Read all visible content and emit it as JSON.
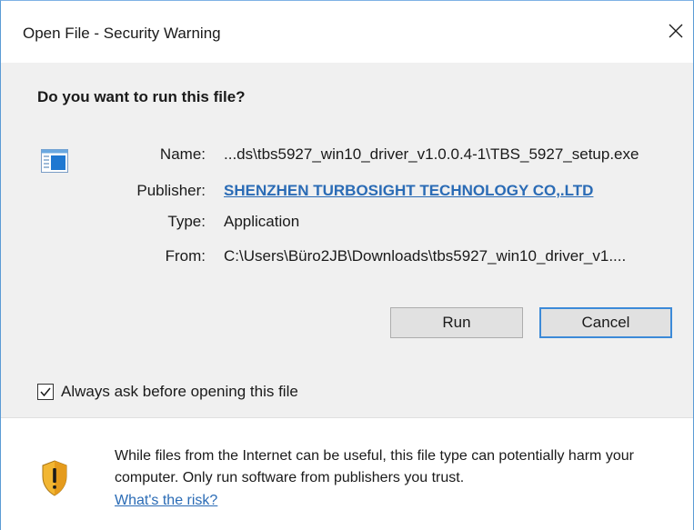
{
  "window": {
    "title": "Open File - Security Warning"
  },
  "prompt": {
    "question": "Do you want to run this file?"
  },
  "file_info": {
    "name_label": "Name:",
    "name_value": "...ds\\tbs5927_win10_driver_v1.0.0.4-1\\TBS_5927_setup.exe",
    "publisher_label": "Publisher:",
    "publisher_value": "SHENZHEN TURBOSIGHT TECHNOLOGY CO,.LTD",
    "type_label": "Type:",
    "type_value": "Application",
    "from_label": "From:",
    "from_value": "C:\\Users\\Büro2JB\\Downloads\\tbs5927_win10_driver_v1...."
  },
  "buttons": {
    "run_label": "Run",
    "cancel_label": "Cancel"
  },
  "options": {
    "always_ask_label": "Always ask before opening this file",
    "always_ask_checked": true
  },
  "footer": {
    "warning_text": "While files from the Internet can be useful, this file type can potentially harm your computer. Only run software from publishers you trust.",
    "risk_link": "What's the risk?"
  },
  "colors": {
    "link": "#2a6bb5",
    "accent_border": "#3c8ad8",
    "content_bg": "#f0f0f0"
  },
  "icons": {
    "close": "close-icon",
    "file": "application-file-icon",
    "checkbox": "checkmark-icon",
    "shield": "warning-shield-icon"
  }
}
